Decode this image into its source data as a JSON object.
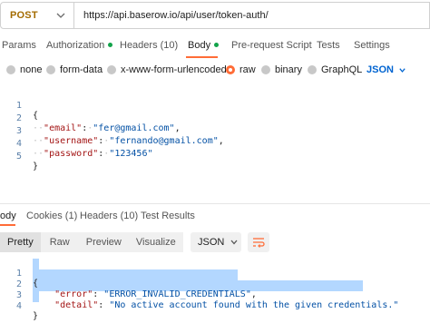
{
  "request": {
    "method": "POST",
    "url": "https://api.baserow.io/api/user/token-auth/"
  },
  "request_tabs": [
    {
      "label": "Params",
      "dot": false
    },
    {
      "label": "Authorization",
      "dot": true
    },
    {
      "label": "Headers (10)",
      "dot": false
    },
    {
      "label": "Body",
      "dot": true,
      "active": true
    },
    {
      "label": "Pre-request Script",
      "dot": false
    },
    {
      "label": "Tests",
      "dot": false
    },
    {
      "label": "Settings",
      "dot": false
    }
  ],
  "body_types": [
    {
      "label": "none",
      "selected": false
    },
    {
      "label": "form-data",
      "selected": false
    },
    {
      "label": "x-www-form-urlencoded",
      "selected": false
    },
    {
      "label": "raw",
      "selected": true
    },
    {
      "label": "binary",
      "selected": false
    },
    {
      "label": "GraphQL",
      "selected": false
    }
  ],
  "raw_format": "JSON",
  "request_body": {
    "line_numbers": [
      "1",
      "2",
      "3",
      "4",
      "5"
    ],
    "open_brace": "{",
    "close_brace": "}",
    "fields": [
      {
        "key": "\"email\"",
        "value": "\"fer@gmail.com\"",
        "comma": ","
      },
      {
        "key": "\"username\"",
        "value": "\"fernando@gmail.com\"",
        "comma": ","
      },
      {
        "key": "\"password\"",
        "value": "\"123456\"",
        "comma": ""
      }
    ]
  },
  "response_tabs": [
    {
      "label": "ody",
      "active": true
    },
    {
      "label": "Cookies (1)"
    },
    {
      "label": "Headers (10)"
    },
    {
      "label": "Test Results"
    }
  ],
  "view_modes": [
    "Pretty",
    "Raw",
    "Preview",
    "Visualize"
  ],
  "response_format": "JSON",
  "response_body": {
    "line_numbers": [
      "1",
      "2",
      "3",
      "4"
    ],
    "open_brace": "{",
    "close_brace": "}",
    "fields": [
      {
        "key": "\"error\"",
        "value": "\"ERROR_INVALID_CREDENTIALS\"",
        "comma": ","
      },
      {
        "key": "\"detail\"",
        "value": "\"No active account found with the given credentials.\"",
        "comma": ""
      }
    ]
  },
  "colors": {
    "accent": "#ff6c37",
    "method_post": "#a36b00",
    "link_blue": "#0064d1",
    "status_dot": "#12a34a",
    "selection": "#b3d7ff"
  }
}
